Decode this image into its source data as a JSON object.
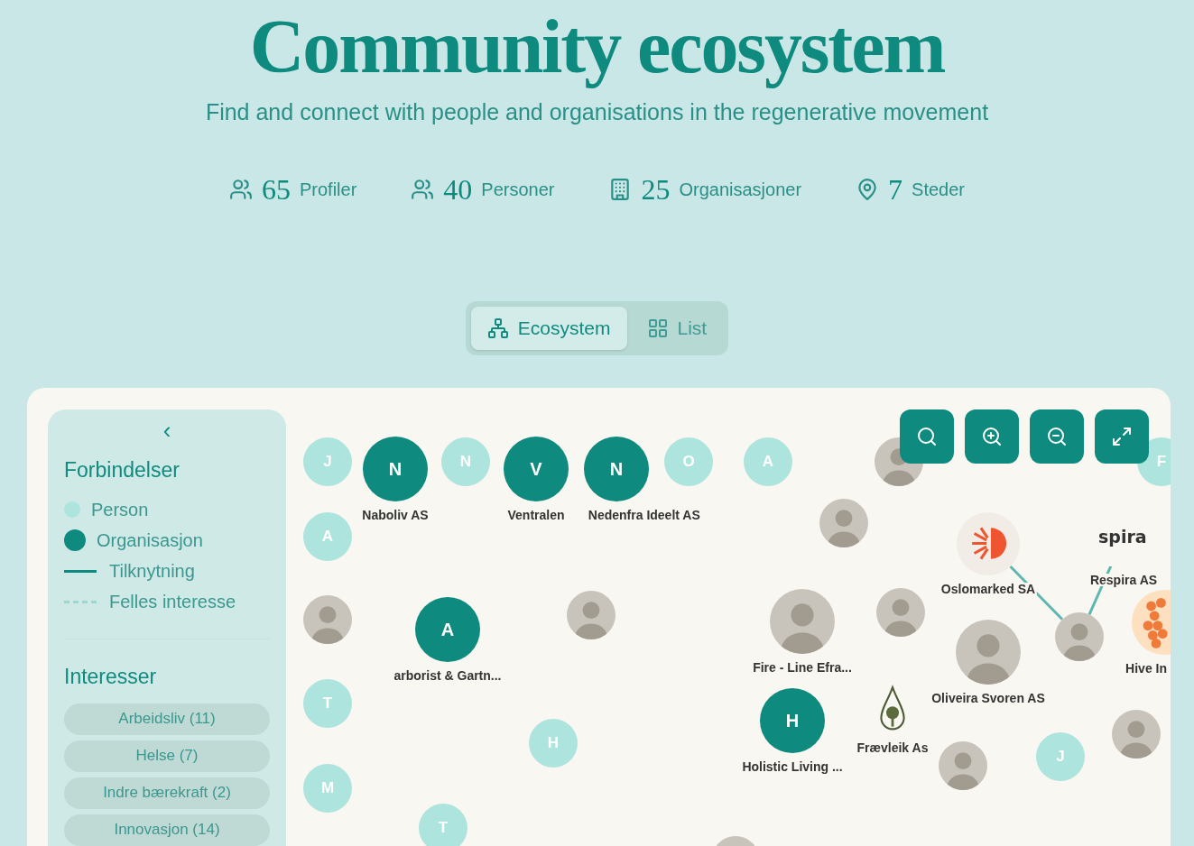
{
  "title": "Community ecosystem",
  "subtitle": "Find and connect with people and organisations in the regenerative movement",
  "stats": [
    {
      "value": "65",
      "label": "Profiler"
    },
    {
      "value": "40",
      "label": "Personer"
    },
    {
      "value": "25",
      "label": "Organisasjoner"
    },
    {
      "value": "7",
      "label": "Steder"
    }
  ],
  "view_tabs": [
    {
      "label": "Ecosystem",
      "selected": true
    },
    {
      "label": "List",
      "selected": false
    }
  ],
  "sidebar": {
    "collapse": "‹",
    "legend_title": "Forbindelser",
    "legend": [
      {
        "kind": "person",
        "label": "Person"
      },
      {
        "kind": "organisation",
        "label": "Organisasjon"
      },
      {
        "kind": "solid",
        "label": "Tilknytning"
      },
      {
        "kind": "dashed",
        "label": "Felles interesse"
      }
    ],
    "interests_title": "Interesser",
    "interests": [
      "Arbeidsliv (11)",
      "Helse (7)",
      "Indre bærekraft (2)",
      "Innovasjon (14)"
    ]
  },
  "graph": {
    "nodes": [
      {
        "kind": "person",
        "initial": "J"
      },
      {
        "kind": "organisation",
        "initial": "N",
        "label": "Naboliv AS"
      },
      {
        "kind": "person",
        "initial": "N"
      },
      {
        "kind": "organisation",
        "initial": "V",
        "label": "Ventralen"
      },
      {
        "kind": "organisation",
        "initial": "N",
        "label": "Nedenfra Ideelt AS"
      },
      {
        "kind": "person",
        "initial": "O"
      },
      {
        "kind": "person",
        "initial": "A"
      },
      {
        "kind": "person",
        "initial": "A"
      },
      {
        "kind": "photo"
      },
      {
        "kind": "organisation",
        "initial": "A",
        "label": "arborist & Gartn..."
      },
      {
        "kind": "photo"
      },
      {
        "kind": "person",
        "initial": "T"
      },
      {
        "kind": "person",
        "initial": "H"
      },
      {
        "kind": "person",
        "initial": "M"
      },
      {
        "kind": "person",
        "initial": "T"
      },
      {
        "kind": "photo"
      },
      {
        "kind": "photo"
      },
      {
        "kind": "logo",
        "label": "Oslomarked SA"
      },
      {
        "kind": "logo",
        "logo_text": "spira",
        "label": "Respira AS"
      },
      {
        "kind": "photo"
      },
      {
        "kind": "photo",
        "label": "Fire - Line Efra..."
      },
      {
        "kind": "photo",
        "label": "Oliveira Svoren AS"
      },
      {
        "kind": "photo"
      },
      {
        "kind": "logo",
        "label": "Hive In"
      },
      {
        "kind": "organisation",
        "initial": "H",
        "label": "Holistic Living ..."
      },
      {
        "kind": "logo",
        "label": "Frævleik As"
      },
      {
        "kind": "photo"
      },
      {
        "kind": "person",
        "initial": "J"
      },
      {
        "kind": "photo"
      },
      {
        "kind": "photo"
      },
      {
        "kind": "person",
        "initial": "F"
      }
    ]
  }
}
